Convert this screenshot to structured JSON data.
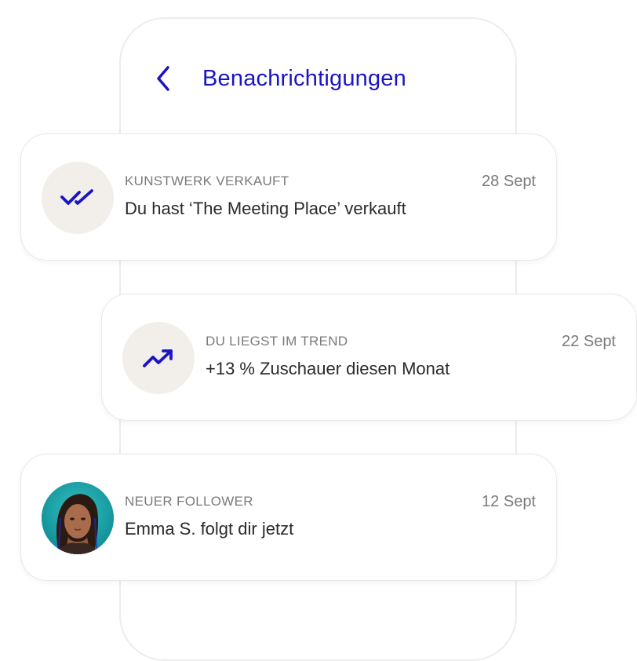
{
  "header": {
    "title": "Benachrichtigungen",
    "back_icon": "chevron-left-icon",
    "accent_color": "#1b14c4"
  },
  "notifications": [
    {
      "icon": "double-check-icon",
      "category": "KUNSTWERK VERKAUFT",
      "message": "Du hast ‘The Meeting Place’ verkauft",
      "date": "28 Sept"
    },
    {
      "icon": "trending-up-icon",
      "category": "DU LIEGST IM TREND",
      "message": "+13 % Zuschauer diesen Monat",
      "date": "22 Sept"
    },
    {
      "icon": "avatar",
      "category": "NEUER FOLLOWER",
      "message": "Emma S. folgt dir jetzt",
      "date": "12 Sept"
    }
  ]
}
